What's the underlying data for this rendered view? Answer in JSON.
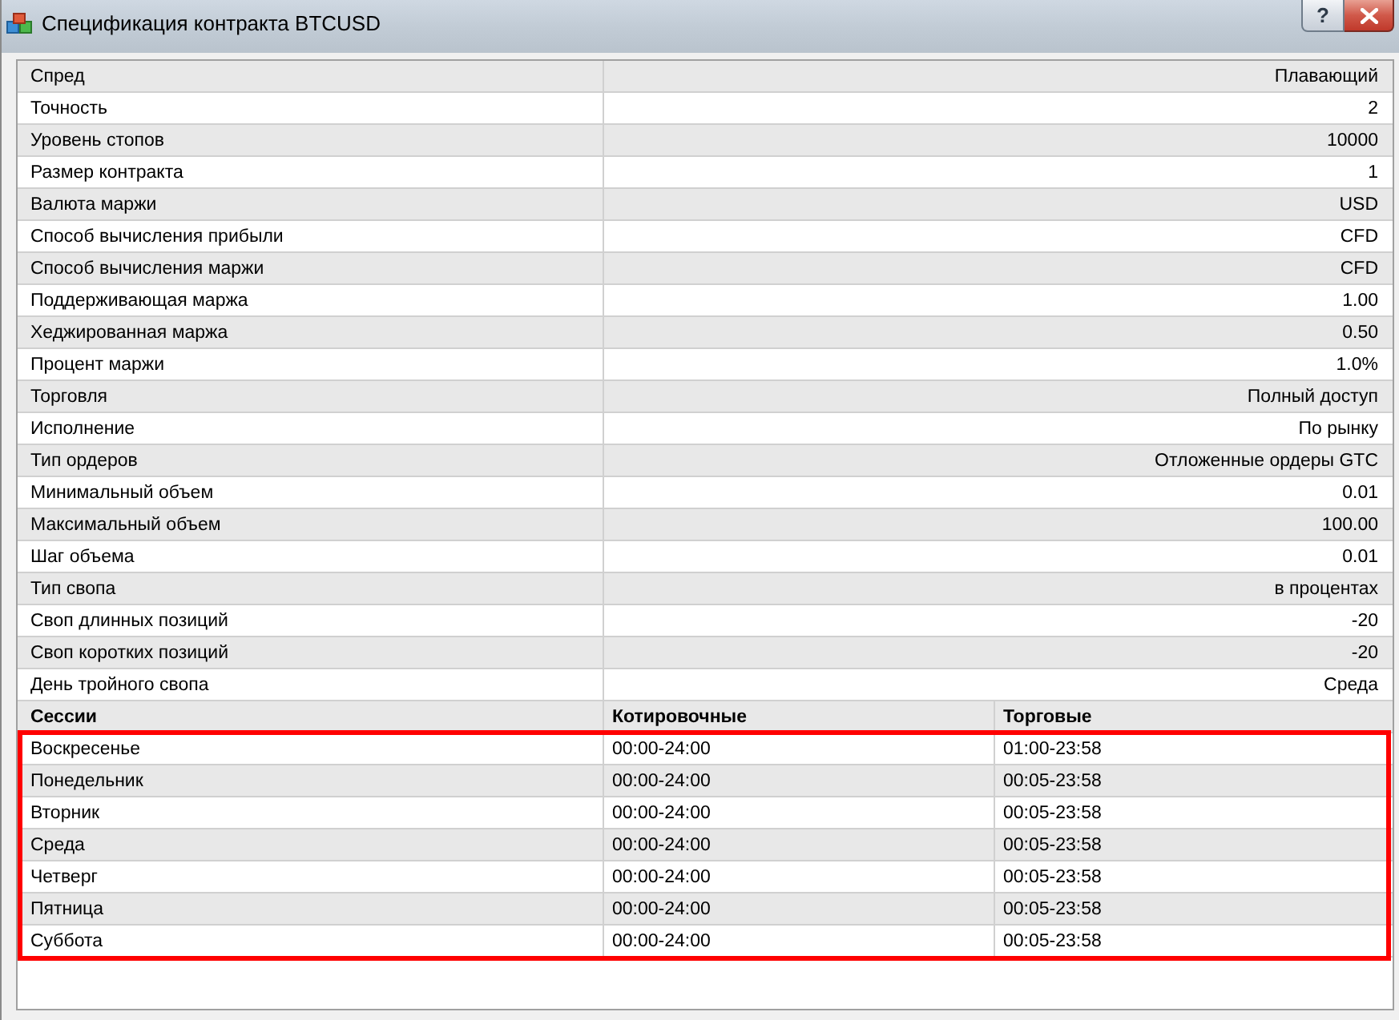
{
  "window": {
    "title": "Спецификация контракта BTCUSD",
    "help_button": "?"
  },
  "specification": [
    {
      "label": "Спред",
      "value": "Плавающий"
    },
    {
      "label": "Точность",
      "value": "2"
    },
    {
      "label": "Уровень стопов",
      "value": "10000"
    },
    {
      "label": "Размер контракта",
      "value": "1"
    },
    {
      "label": "Валюта маржи",
      "value": "USD"
    },
    {
      "label": "Способ вычисления прибыли",
      "value": "CFD"
    },
    {
      "label": "Способ вычисления маржи",
      "value": "CFD"
    },
    {
      "label": "Поддерживающая маржа",
      "value": "1.00"
    },
    {
      "label": "Хеджированная маржа",
      "value": "0.50"
    },
    {
      "label": "Процент маржи",
      "value": "1.0%"
    },
    {
      "label": "Торговля",
      "value": "Полный доступ"
    },
    {
      "label": "Исполнение",
      "value": "По рынку"
    },
    {
      "label": "Тип ордеров",
      "value": "Отложенные ордеры GTC"
    },
    {
      "label": "Минимальный объем",
      "value": "0.01"
    },
    {
      "label": "Максимальный объем",
      "value": "100.00"
    },
    {
      "label": "Шаг объема",
      "value": "0.01"
    },
    {
      "label": "Тип свопа",
      "value": "в процентах"
    },
    {
      "label": "Своп длинных позиций",
      "value": "-20"
    },
    {
      "label": "Своп коротких позиций",
      "value": "-20"
    },
    {
      "label": "День тройного свопа",
      "value": "Среда"
    }
  ],
  "sessions": {
    "highlighted": true,
    "columns": [
      "Сессии",
      "Котировочные",
      "Торговые"
    ],
    "rows": [
      [
        "Воскресенье",
        "00:00-24:00",
        "01:00-23:58"
      ],
      [
        "Понедельник",
        "00:00-24:00",
        "00:05-23:58"
      ],
      [
        "Вторник",
        "00:00-24:00",
        "00:05-23:58"
      ],
      [
        "Среда",
        "00:00-24:00",
        "00:05-23:58"
      ],
      [
        "Четверг",
        "00:00-24:00",
        "00:05-23:58"
      ],
      [
        "Пятница",
        "00:00-24:00",
        "00:05-23:58"
      ],
      [
        "Суббота",
        "00:00-24:00",
        "00:05-23:58"
      ]
    ]
  }
}
